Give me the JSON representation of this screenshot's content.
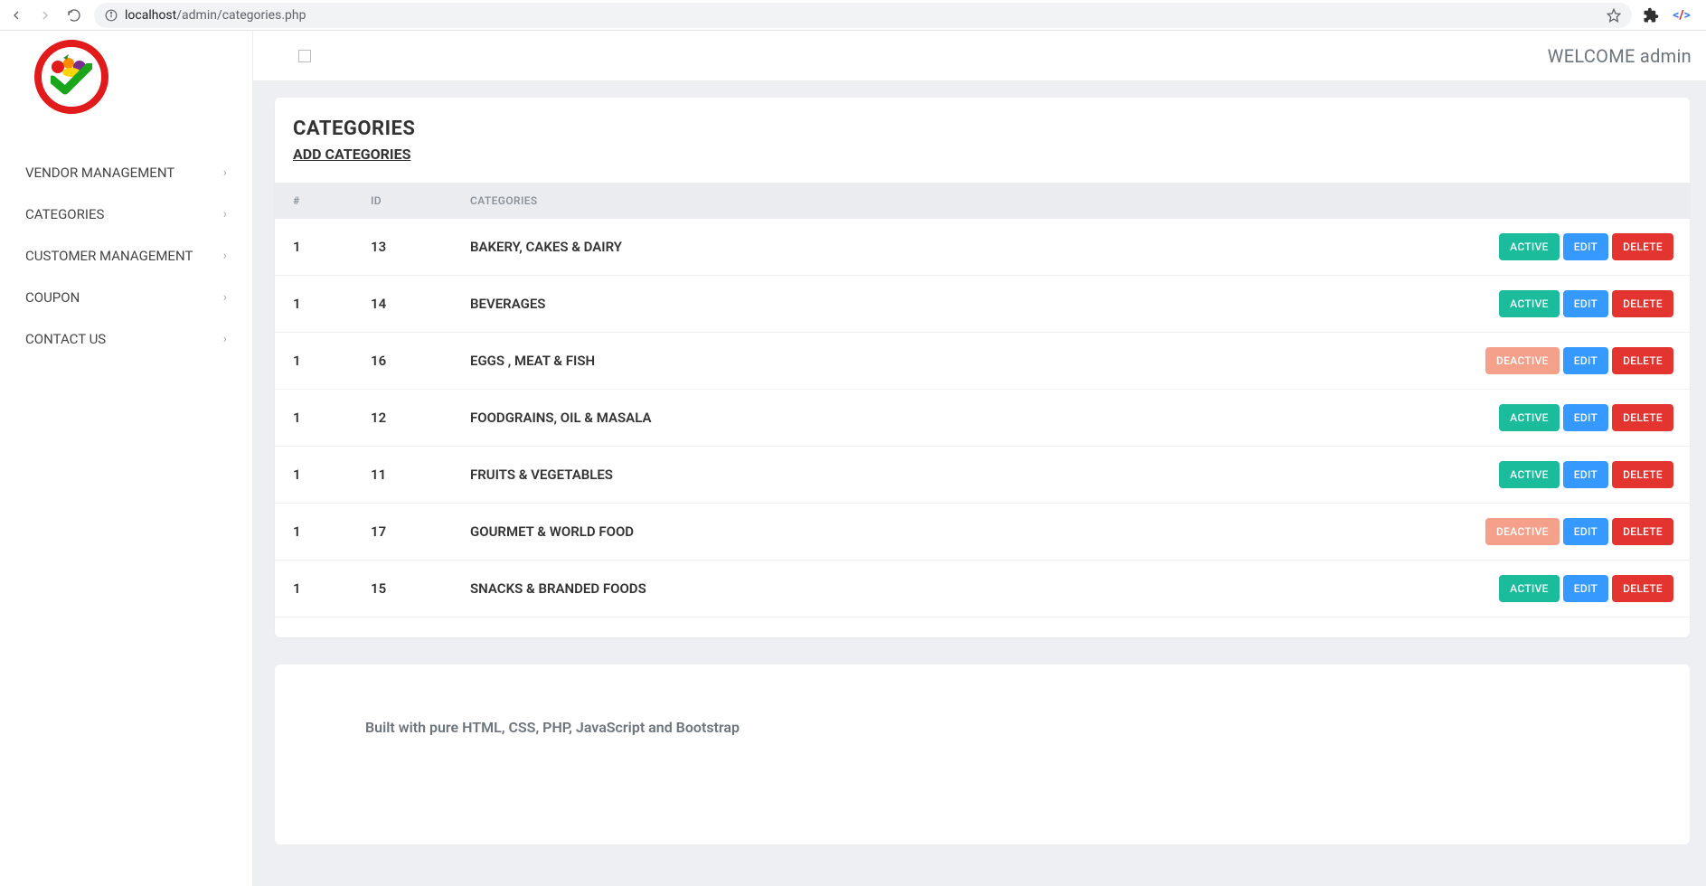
{
  "browser": {
    "url_host": "localhost",
    "url_path": "/admin/categories.php"
  },
  "header": {
    "welcome": "WELCOME admin"
  },
  "sidebar": {
    "items": [
      {
        "label": "VENDOR MANAGEMENT"
      },
      {
        "label": "CATEGORIES"
      },
      {
        "label": "CUSTOMER MANAGEMENT"
      },
      {
        "label": "COUPON"
      },
      {
        "label": "CONTACT US"
      }
    ]
  },
  "page": {
    "title": "CATEGORIES",
    "add_link": "ADD CATEGORIES"
  },
  "table": {
    "headers": {
      "num": "#",
      "id": "ID",
      "name": "CATEGORIES"
    },
    "rows": [
      {
        "num": "1",
        "id": "13",
        "name": "BAKERY, CAKES & DAIRY",
        "status": "ACTIVE"
      },
      {
        "num": "1",
        "id": "14",
        "name": "BEVERAGES",
        "status": "ACTIVE"
      },
      {
        "num": "1",
        "id": "16",
        "name": "EGGS , MEAT & FISH",
        "status": "DEACTIVE"
      },
      {
        "num": "1",
        "id": "12",
        "name": "FOODGRAINS, OIL & MASALA",
        "status": "ACTIVE"
      },
      {
        "num": "1",
        "id": "11",
        "name": "FRUITS & VEGETABLES",
        "status": "ACTIVE"
      },
      {
        "num": "1",
        "id": "17",
        "name": "GOURMET & WORLD FOOD",
        "status": "DEACTIVE"
      },
      {
        "num": "1",
        "id": "15",
        "name": "SNACKS & BRANDED FOODS",
        "status": "ACTIVE"
      }
    ],
    "buttons": {
      "edit": "EDIT",
      "delete": "DELETE"
    }
  },
  "footer": {
    "text": "Built with pure HTML, CSS, PHP, JavaScript and Bootstrap"
  }
}
